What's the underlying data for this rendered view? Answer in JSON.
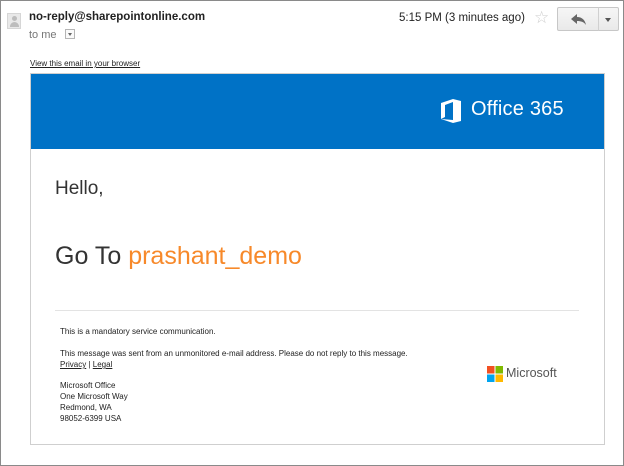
{
  "header": {
    "sender": "no-reply@sharepointonline.com",
    "recipient": "to me",
    "time": "5:15 PM (3 minutes ago)"
  },
  "email": {
    "view_in_browser": "View this email in your browser",
    "brand": "Office 365",
    "greeting": "Hello,",
    "goto_prefix": "Go To",
    "site_name": "prashant_demo",
    "footer": {
      "mandatory": "This is a mandatory service communication.",
      "unmonitored": "This message was sent from an unmonitored e-mail address. Please do not reply to this message.",
      "privacy": "Privacy",
      "separator": "|",
      "legal": "Legal",
      "address": [
        "Microsoft Office",
        "One Microsoft Way",
        "Redmond, WA",
        "98052-6399 USA"
      ],
      "ms_brand": "Microsoft"
    }
  },
  "icons": {
    "avatar": "avatar-icon",
    "star": "star-icon",
    "reply": "reply-icon",
    "more": "chevron-down-icon"
  },
  "colors": {
    "banner": "#0072c6",
    "site_link": "#f7892a",
    "ms_red": "#f25022",
    "ms_green": "#7fba00",
    "ms_blue": "#00a4ef",
    "ms_yellow": "#ffb900"
  }
}
